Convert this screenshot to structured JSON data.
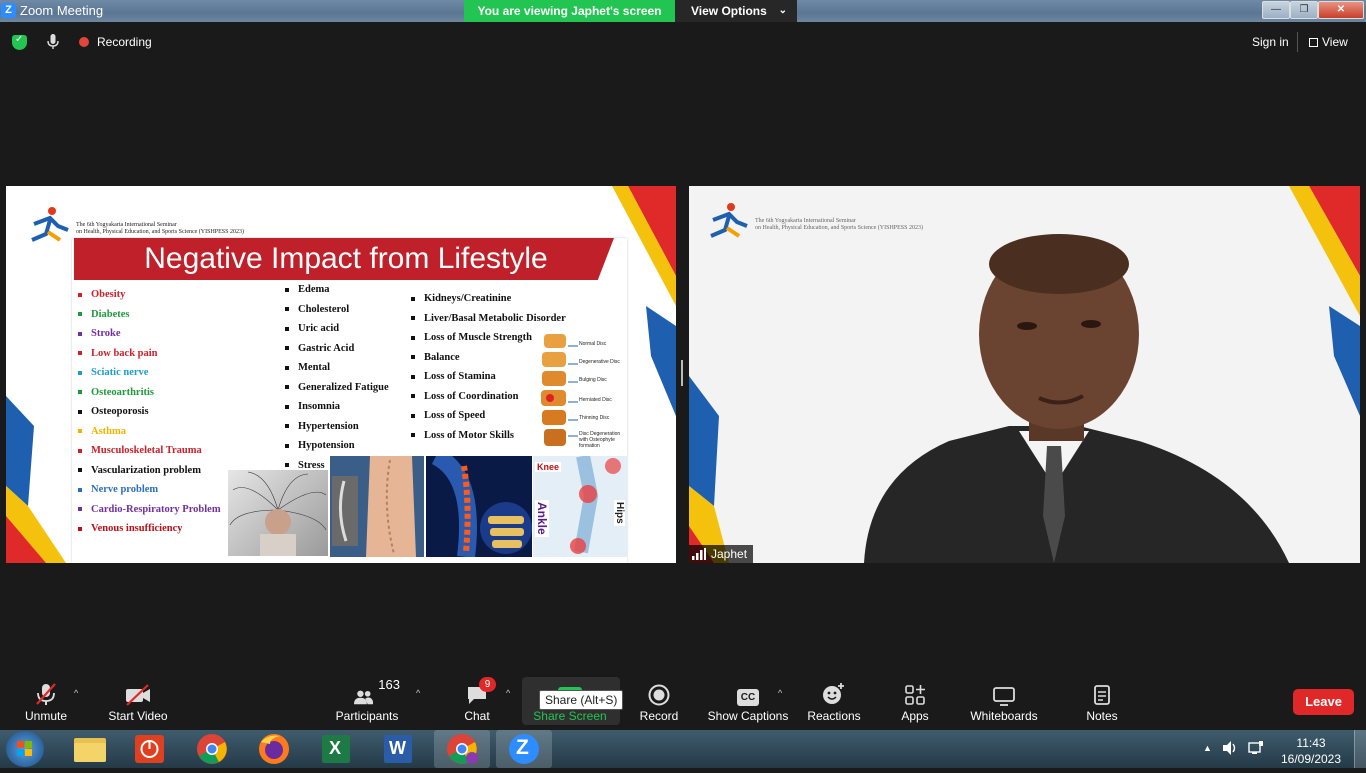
{
  "window": {
    "app_title": "Zoom Meeting",
    "viewing_banner": "You are viewing Japhet's screen",
    "view_options": "View Options",
    "min": "—",
    "max": "❐",
    "close": "✕"
  },
  "meeting_bar": {
    "recording": "Recording",
    "sign_in": "Sign in",
    "view": "View"
  },
  "slide": {
    "seminar_line1": "The 6th Yogyakarta International Seminar",
    "seminar_line2": "on Health, Physical Education, and Sports Science (YISHPESS 2023)",
    "title": "Negative Impact from Lifestyle",
    "column1": [
      {
        "text": "Obesity",
        "color": "#d0202a"
      },
      {
        "text": "Diabetes",
        "color": "#1e9a3c"
      },
      {
        "text": "Stroke",
        "color": "#7030a0"
      },
      {
        "text": "Low back pain",
        "color": "#d0202a"
      },
      {
        "text": "Sciatic nerve",
        "color": "#1aa0c8"
      },
      {
        "text": "Osteoarthritis",
        "color": "#1e9a3c"
      },
      {
        "text": "Osteoporosis",
        "color": "#111111"
      },
      {
        "text": "Asthma",
        "color": "#f0b400"
      },
      {
        "text": "Musculoskeletal Trauma",
        "color": "#d0202a"
      },
      {
        "text": "Vascularization problem",
        "color": "#111111"
      },
      {
        "text": "Nerve problem",
        "color": "#2a6fc0"
      },
      {
        "text": "Cardio-Respiratory Problem",
        "color": "#7030a0"
      },
      {
        "text": "Venous insufficiency",
        "color": "#c0101a"
      }
    ],
    "column2": [
      "Edema",
      "Cholesterol",
      "Uric acid",
      "Gastric Acid",
      "Mental",
      "Generalized Fatigue",
      "Insomnia",
      "Hypertension",
      "Hypotension",
      "Stress"
    ],
    "column3": [
      "Kidneys/Creatinine",
      "Liver/Basal Metabolic Disorder",
      "Loss of Muscle Strength",
      "Balance",
      "Loss of Stamina",
      "Loss of Coordination",
      "Loss of Speed",
      "Loss of Motor Skills"
    ],
    "disc_labels": [
      "Normal Disc",
      "Degenerative Disc",
      "Bulging Disc",
      "Herniated Disc",
      "Thinning Disc",
      "Disc Degeneration with Osteophyte formation"
    ],
    "joint_labels": {
      "knee": "Knee",
      "ankle": "Ankle",
      "hips": "Hips"
    }
  },
  "speaker": {
    "name": "Japhet",
    "seminar_line1": "The 6th Yogyakarta International Seminar",
    "seminar_line2": "on Health, Physical Education, and Sports Science (YISHPESS 2023)"
  },
  "toolbar": {
    "unmute": "Unmute",
    "start_video": "Start Video",
    "participants": "Participants",
    "participants_count": "163",
    "chat": "Chat",
    "chat_badge": "9",
    "share_screen": "Share Screen",
    "share_tooltip": "Share (Alt+S)",
    "record": "Record",
    "show_captions": "Show Captions",
    "cc": "CC",
    "reactions": "Reactions",
    "apps": "Apps",
    "whiteboards": "Whiteboards",
    "notes": "Notes",
    "leave": "Leave"
  },
  "taskbar": {
    "time": "11:43",
    "date": "16/09/2023",
    "zoom_letter": "Z",
    "excel_letter": "X",
    "word_letter": "W"
  }
}
